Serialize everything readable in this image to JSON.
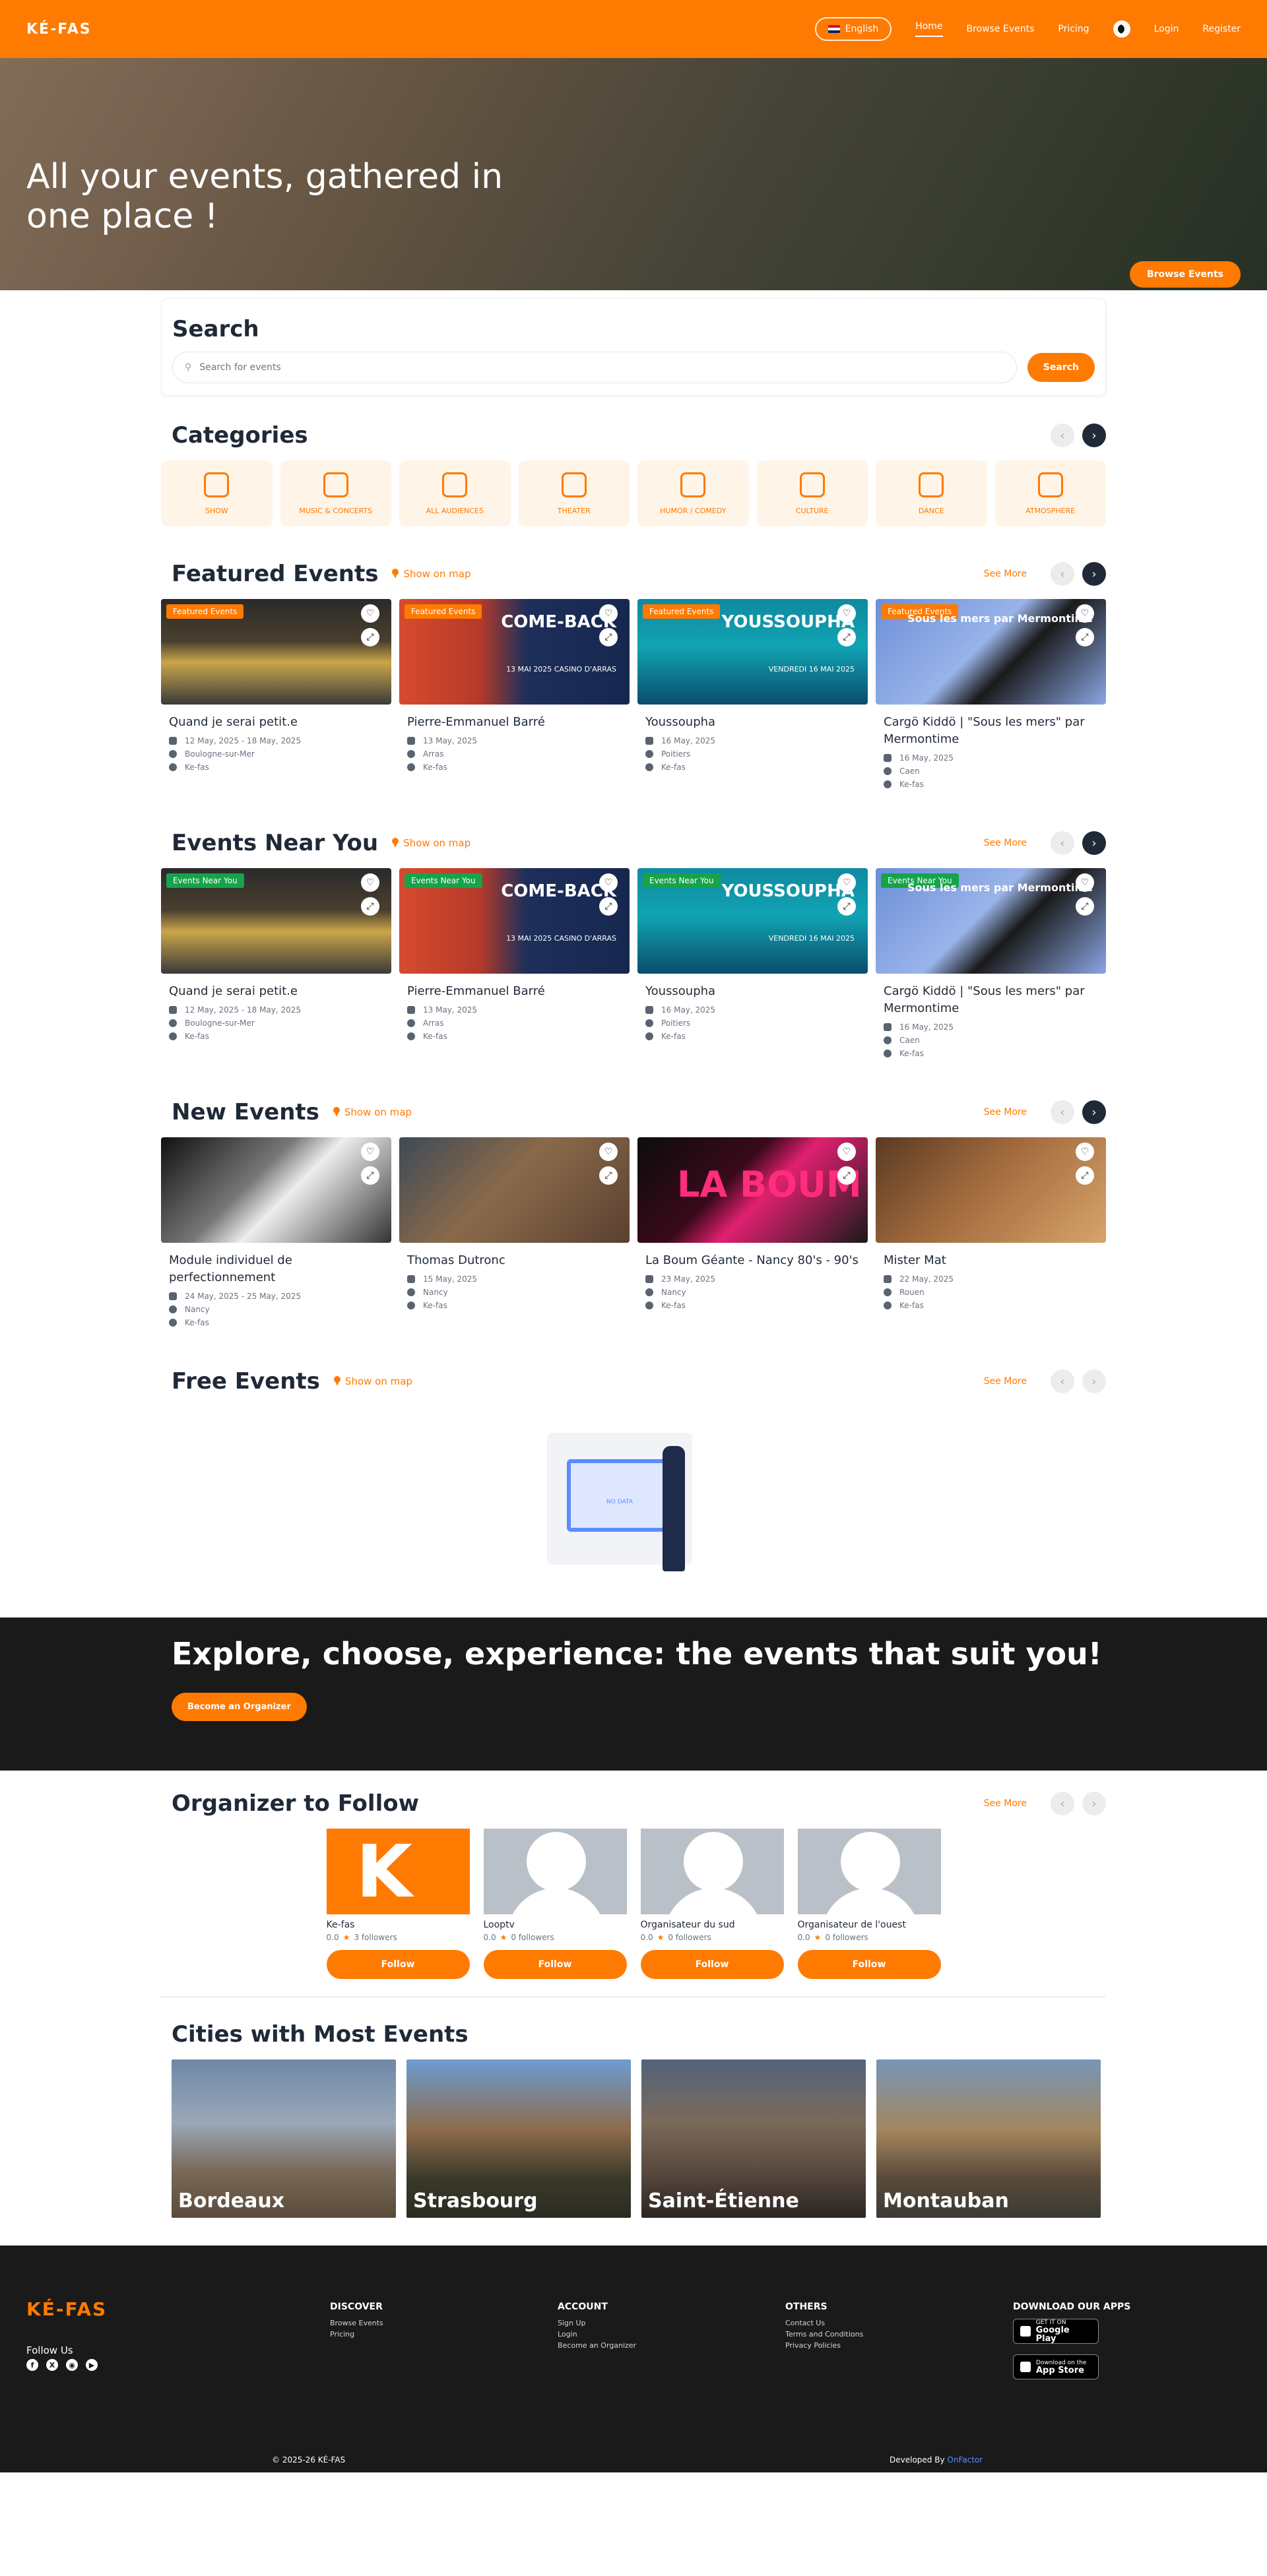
{
  "header": {
    "logo": "KÉ-FAS",
    "language": "English",
    "nav": [
      "Home",
      "Browse Events",
      "Pricing"
    ],
    "login": "Login",
    "register": "Register"
  },
  "hero": {
    "title": "All your events, gathered in one place !",
    "button": "Browse Events"
  },
  "search": {
    "title": "Search",
    "placeholder": "Search for events",
    "button": "Search"
  },
  "categories": {
    "title": "Categories",
    "items": [
      "SHOW",
      "MUSIC & CONCERTS",
      "ALL AUDIENCES",
      "THEATER",
      "HUMOR / COMEDY",
      "CULTURE",
      "DANCE",
      "ATMOSPHERE"
    ]
  },
  "common": {
    "show_on_map": "Show on map",
    "see_more": "See More",
    "organizer": "Ke-fas"
  },
  "featured": {
    "title": "Featured Events",
    "badge": "Featured Events",
    "events": [
      {
        "name": "Quand je serai petit.e",
        "date": "12 May, 2025 - 18 May, 2025",
        "city": "Boulogne-sur-Mer"
      },
      {
        "name": "Pierre-Emmanuel Barré",
        "date": "13 May, 2025",
        "city": "Arras",
        "overlay": "COME-BACK",
        "overlay_sub": "13 MAI 2025 CASINO D'ARRAS"
      },
      {
        "name": "Youssoupha",
        "date": "16 May, 2025",
        "city": "Poitiers",
        "overlay": "YOUSSOUPHA",
        "overlay_sub": "VENDREDI 16 MAI 2025"
      },
      {
        "name": "Cargö Kiddö | \"Sous les mers\" par Mermontime",
        "date": "16 May, 2025",
        "city": "Caen",
        "overlay": "Sous les mers par Mermontime"
      }
    ]
  },
  "nearby": {
    "title": "Events Near You",
    "badge": "Events Near You",
    "events": [
      {
        "name": "Quand je serai petit.e",
        "date": "12 May, 2025 - 18 May, 2025",
        "city": "Boulogne-sur-Mer"
      },
      {
        "name": "Pierre-Emmanuel Barré",
        "date": "13 May, 2025",
        "city": "Arras",
        "overlay": "COME-BACK",
        "overlay_sub": "13 MAI 2025 CASINO D'ARRAS"
      },
      {
        "name": "Youssoupha",
        "date": "16 May, 2025",
        "city": "Poitiers",
        "overlay": "YOUSSOUPHA",
        "overlay_sub": "VENDREDI 16 MAI 2025"
      },
      {
        "name": "Cargö Kiddö | \"Sous les mers\" par Mermontime",
        "date": "16 May, 2025",
        "city": "Caen",
        "overlay": "Sous les mers par Mermontime"
      }
    ]
  },
  "new_events": {
    "title": "New Events",
    "events": [
      {
        "name": "Module individuel de perfectionnement",
        "date": "24 May, 2025 - 25 May, 2025",
        "city": "Nancy"
      },
      {
        "name": "Thomas Dutronc",
        "date": "15 May, 2025",
        "city": "Nancy"
      },
      {
        "name": "La Boum Géante - Nancy 80's - 90's",
        "date": "23 May, 2025",
        "city": "Nancy",
        "overlay": "LA BOUM"
      },
      {
        "name": "Mister Mat",
        "date": "22 May, 2025",
        "city": "Rouen"
      }
    ]
  },
  "free_events": {
    "title": "Free Events",
    "empty_label": "NO DATA"
  },
  "explore": {
    "title": "Explore, choose, experience: the events that suit you!",
    "button": "Become an Organizer"
  },
  "organizers": {
    "title": "Organizer to Follow",
    "follow_label": "Follow",
    "items": [
      {
        "name": "Ke-fas",
        "rating": "0.0",
        "followers": "3 followers"
      },
      {
        "name": "Looptv",
        "rating": "0.0",
        "followers": "0 followers"
      },
      {
        "name": "Organisateur du sud",
        "rating": "0.0",
        "followers": "0 followers"
      },
      {
        "name": "Organisateur de l'ouest",
        "rating": "0.0",
        "followers": "0 followers"
      }
    ]
  },
  "cities": {
    "title": "Cities with Most Events",
    "items": [
      "Bordeaux",
      "Strasbourg",
      "Saint-Étienne",
      "Montauban"
    ]
  },
  "footer": {
    "logo": "KÉ-FAS",
    "follow_us": "Follow Us",
    "discover": {
      "title": "DISCOVER",
      "links": [
        "Browse Events",
        "Pricing"
      ]
    },
    "account": {
      "title": "ACCOUNT",
      "links": [
        "Sign Up",
        "Login",
        "Become an Organizer"
      ]
    },
    "others": {
      "title": "OTHERS",
      "links": [
        "Contact Us",
        "Terms and Conditions",
        "Privacy Policies"
      ]
    },
    "apps": {
      "title": "DOWNLOAD OUR APPS",
      "google_top": "GET IT ON",
      "google": "Google Play",
      "apple_top": "Download on the",
      "apple": "App Store"
    },
    "copyright": "© 2025-26 KÉ-FAS",
    "developed_by": "Developed By",
    "developer": "OnFactor"
  },
  "colors": {
    "brand": "#ff7a00",
    "dark": "#1a1a1a",
    "green_badge": "#16a34a"
  }
}
